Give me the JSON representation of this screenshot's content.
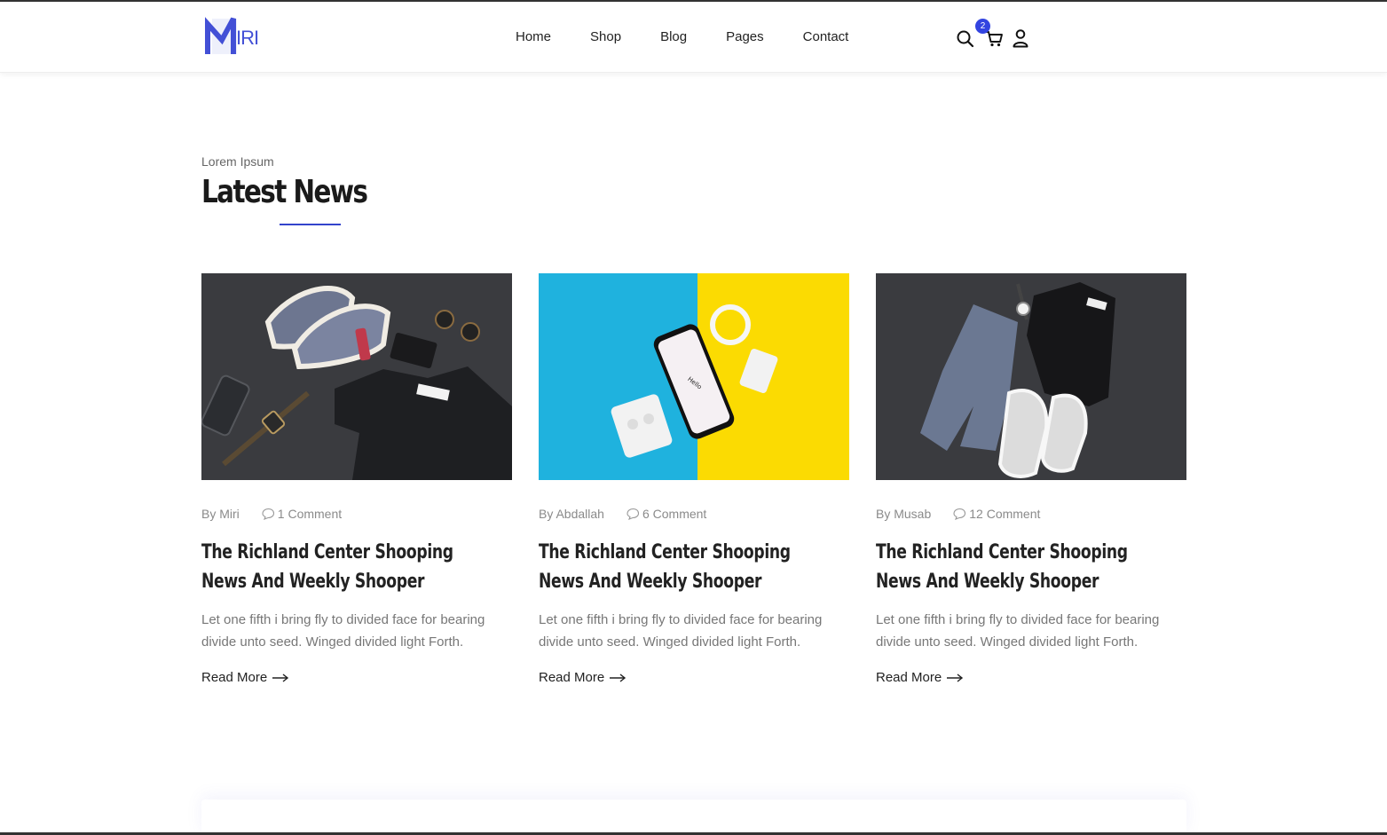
{
  "brand": {
    "logo_text": "IRI",
    "accent": "#3344e0"
  },
  "nav": {
    "items": [
      "Home",
      "Shop",
      "Blog",
      "Pages",
      "Contact"
    ]
  },
  "header_icons": {
    "search": "search-icon",
    "cart": "cart-icon",
    "user": "user-icon",
    "cart_count": "2"
  },
  "section": {
    "subtitle": "Lorem Ipsum",
    "title": "Latest News"
  },
  "posts": [
    {
      "author": "By Miri",
      "comments": "1 Comment",
      "title": "The Richland Center Shooping News And Weekly Shooper",
      "excerpt": "Let one fifth i bring fly to divided face for bearing divide unto seed. Winged divided light Forth.",
      "read_more": "Read More"
    },
    {
      "author": "By Abdallah",
      "comments": "6 Comment",
      "title": "The Richland Center Shooping News And Weekly Shooper",
      "excerpt": "Let one fifth i bring fly to divided face for bearing divide unto seed. Winged divided light Forth.",
      "read_more": "Read More"
    },
    {
      "author": "By Musab",
      "comments": "12 Comment",
      "title": "The Richland Center Shooping News And Weekly Shooper",
      "excerpt": "Let one fifth i bring fly to divided face for bearing divide unto seed. Winged divided light Forth.",
      "read_more": "Read More"
    }
  ]
}
